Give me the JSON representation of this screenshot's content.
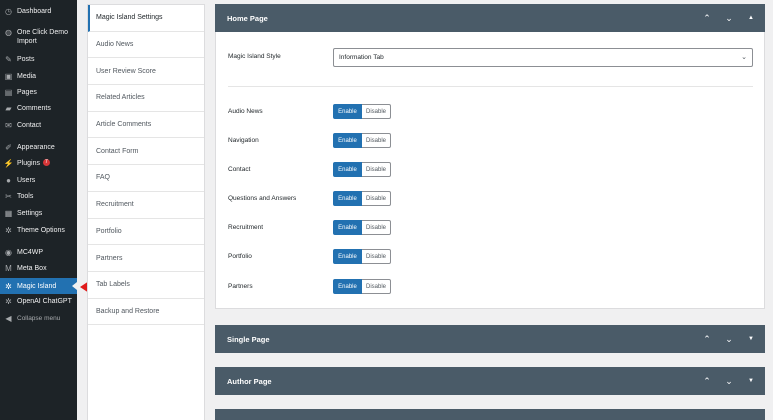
{
  "sidebar": {
    "items": [
      {
        "label": "Dashboard",
        "icon": "dashboard-icon",
        "glyph": "◷"
      },
      {
        "label": "One Click Demo Import",
        "icon": "globe-icon",
        "glyph": "◍"
      },
      {
        "label": "Posts",
        "icon": "pin-icon",
        "glyph": "✎"
      },
      {
        "label": "Media",
        "icon": "media-icon",
        "glyph": "▣"
      },
      {
        "label": "Pages",
        "icon": "pages-icon",
        "glyph": "▤"
      },
      {
        "label": "Comments",
        "icon": "comments-icon",
        "glyph": "▰"
      },
      {
        "label": "Contact",
        "icon": "mail-icon",
        "glyph": "✉"
      },
      {
        "label": "Appearance",
        "icon": "brush-icon",
        "glyph": "✐"
      },
      {
        "label": "Plugins",
        "icon": "plugin-icon",
        "glyph": "⚡",
        "badge": "7"
      },
      {
        "label": "Users",
        "icon": "users-icon",
        "glyph": "●"
      },
      {
        "label": "Tools",
        "icon": "wrench-icon",
        "glyph": "✂"
      },
      {
        "label": "Settings",
        "icon": "settings-icon",
        "glyph": "▦"
      },
      {
        "label": "Theme Options",
        "icon": "gear-icon",
        "glyph": "✲"
      },
      {
        "label": "MC4WP",
        "icon": "mc4wp-icon",
        "glyph": "◉"
      },
      {
        "label": "Meta Box",
        "icon": "metabox-icon",
        "glyph": "M"
      },
      {
        "label": "Magic Island",
        "icon": "gear-icon",
        "glyph": "✲",
        "active": true
      },
      {
        "label": "OpenAI ChatGPT",
        "icon": "gear-icon",
        "glyph": "✲"
      },
      {
        "label": "Collapse menu",
        "icon": "collapse-icon",
        "glyph": "◀",
        "collapse": true
      }
    ]
  },
  "tabs": [
    "Magic Island Settings",
    "Audio News",
    "User Review Score",
    "Related Articles",
    "Article Comments",
    "Contact Form",
    "FAQ",
    "Recruitment",
    "Portfolio",
    "Partners",
    "Tab Labels",
    "Backup and Restore"
  ],
  "home_page": {
    "title": "Home Page",
    "style_label": "Magic Island Style",
    "style_value": "Information Tab",
    "enable_label": "Enable",
    "disable_label": "Disable",
    "options": [
      {
        "label": "Audio News",
        "state": "Enable"
      },
      {
        "label": "Navigation",
        "state": "Enable"
      },
      {
        "label": "Contact",
        "state": "Enable"
      },
      {
        "label": "Questions and Answers",
        "state": "Enable"
      },
      {
        "label": "Recruitment",
        "state": "Enable"
      },
      {
        "label": "Portfolio",
        "state": "Enable"
      },
      {
        "label": "Partners",
        "state": "Enable"
      }
    ]
  },
  "sections": [
    {
      "title": "Single Page"
    },
    {
      "title": "Author Page"
    }
  ],
  "panel_controls": {
    "up": "⌃",
    "down": "⌄",
    "toggle": "▲",
    "toggle_closed": "▼"
  },
  "colors": {
    "accent": "#2271b1",
    "panel_header": "#4a5b68",
    "sidebar": "#1d2327",
    "arrow": "#e01b1b"
  }
}
